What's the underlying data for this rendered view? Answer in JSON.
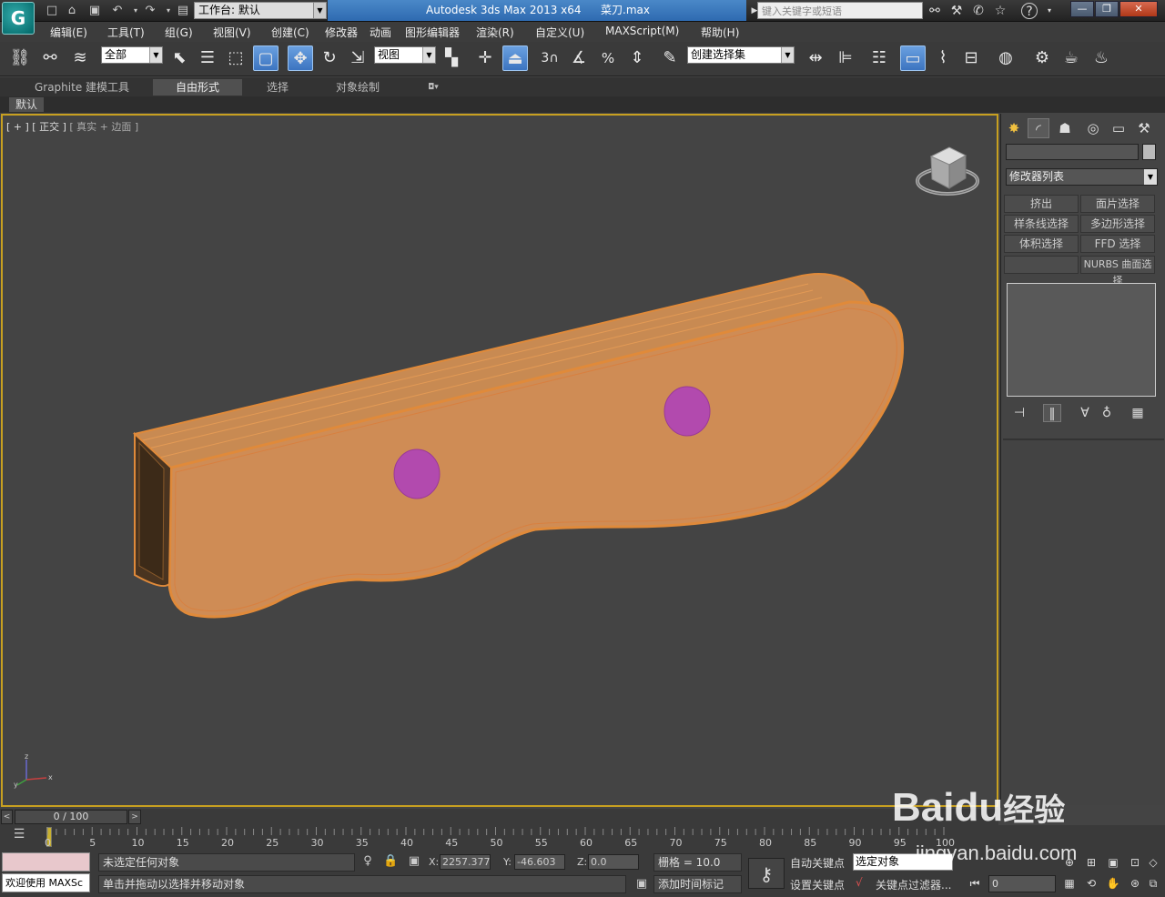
{
  "titlebar": {
    "logo_text": "G",
    "workspace_label": "工作台: 默认",
    "app_title": "Autodesk 3ds Max  2013 x64",
    "file_name": "菜刀.max",
    "search_placeholder": "键入关键字或短语",
    "help_label": "?",
    "btn_minimize": "—",
    "btn_maximize": "❐",
    "btn_close": "✕"
  },
  "menu": {
    "items": [
      "编辑(E)",
      "工具(T)",
      "组(G)",
      "视图(V)",
      "创建(C)",
      "修改器",
      "动画",
      "图形编辑器",
      "渲染(R)",
      "自定义(U)",
      "MAXScript(M)",
      "帮助(H)"
    ]
  },
  "toolbar": {
    "selection_filter": "全部",
    "ref_coord": "视图",
    "snap_3": "3",
    "selection_set": "创建选择集"
  },
  "ribbon": {
    "tabs": [
      "Graphite 建模工具",
      "自由形式",
      "选择",
      "对象绘制"
    ],
    "active_tab": 1,
    "sub_label": "默认"
  },
  "viewport": {
    "label_plus": "[ + ]",
    "label_view": "[ 正交 ]",
    "label_shading": "[ 真实 + 边面 ]",
    "axis_x": "x",
    "axis_z": "z",
    "axis_y": "y",
    "object_color": "#c8884e",
    "hole_color": "#b24aae",
    "edge_color": "#e08a3a"
  },
  "command_panel": {
    "modifier_list": "修改器列表",
    "buttons": [
      "挤出",
      "面片选择",
      "样条线选择",
      "多边形选择",
      "体积选择",
      "FFD 选择",
      "",
      "NURBS 曲面选择"
    ]
  },
  "time": {
    "slider_label": "0 / 100",
    "prev": "<",
    "next": ">",
    "ticks": [
      "0",
      "5",
      "10",
      "15",
      "20",
      "25",
      "30",
      "35",
      "40",
      "45",
      "50",
      "55",
      "60",
      "65",
      "70",
      "75",
      "80",
      "85",
      "90",
      "95",
      "100"
    ]
  },
  "status": {
    "welcome": "欢迎使用 MAXSc",
    "selection_status": "未选定任何对象",
    "prompt": "单击并拖动以选择并移动对象",
    "x_label": "X:",
    "x_value": "2257.377",
    "y_label": "Y:",
    "y_value": "-46.603",
    "z_label": "Z:",
    "z_value": "0.0",
    "grid": "栅格 = 10.0",
    "add_time_tag": "添加时间标记",
    "auto_key": "自动关键点",
    "set_key": "设置关键点",
    "key_mode": "选定对象",
    "key_filters": "关键点过滤器...",
    "frame": "0"
  },
  "watermark": {
    "brand": "Bai",
    "brand_paw": "du",
    "brand_cn": "经验",
    "url": "jingyan.baidu.com"
  }
}
